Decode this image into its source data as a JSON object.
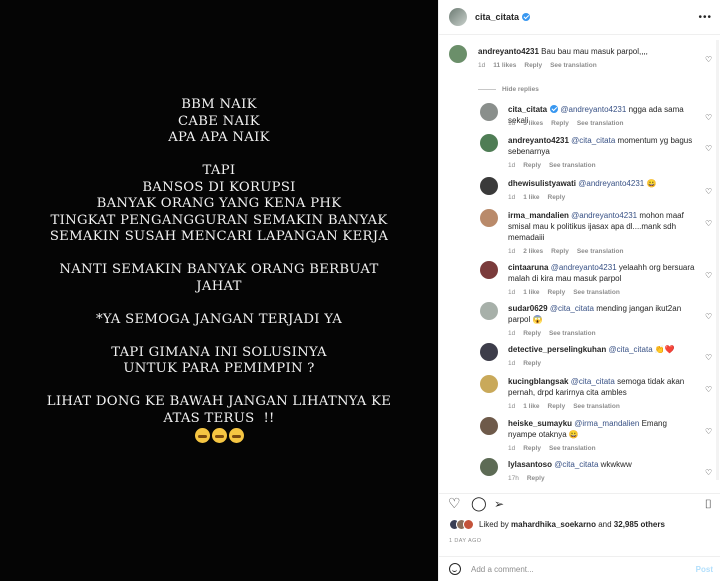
{
  "post": {
    "image_lines": [
      "BBM NAIK",
      "CABE NAIK",
      "APA APA NAIK",
      "",
      "TAPI",
      "BANSOS DI KORUPSI",
      "BANYAK ORANG YANG KENA PHK",
      "TINGKAT PENGANGGURAN SEMAKIN BANYAK",
      "SEMAKIN SUSAH MENCARI LAPANGAN KERJA",
      "",
      "NANTI SEMAKIN BANYAK ORANG BERBUAT",
      "JAHAT",
      "",
      "*YA SEMOGA JANGAN TERJADI YA",
      "",
      "TAPI GIMANA INI SOLUSINYA",
      "UNTUK PARA PEMIMPIN ?",
      "",
      "LIHAT DONG KE BAWAH JANGAN LIHATNYA KE",
      "ATAS TERUS  !!"
    ],
    "emoji": "crying-faces"
  },
  "header": {
    "username": "cita_citata",
    "verified": true
  },
  "comments": [
    {
      "user": "andreyanto4231",
      "mention": "",
      "text": "Bau bau mau masuk parpol,,,,",
      "time": "1d",
      "likes": "11 likes",
      "reply": "Reply",
      "translate": "See translation"
    },
    {
      "user": "cita_citata",
      "verified": true,
      "mention": "@andreyanto4231",
      "text": "ngga ada sama sekali",
      "time": "1d",
      "likes": "5 likes",
      "reply": "Reply",
      "translate": "See translation"
    },
    {
      "user": "andreyanto4231",
      "mention": "@cita_citata",
      "text": "momentum yg bagus sebenarnya",
      "time": "1d",
      "likes": "",
      "reply": "Reply",
      "translate": "See translation"
    },
    {
      "user": "dhewisulistyawati",
      "mention": "@andreyanto4231",
      "text": "😀",
      "time": "1d",
      "likes": "1 like",
      "reply": "Reply",
      "translate": ""
    },
    {
      "user": "irma_mandalien",
      "mention": "@andreyanto4231",
      "text": "mohon maaf smisal mau k politikus ijasax apa dl....mank sdh memadaiii",
      "time": "1d",
      "likes": "2 likes",
      "reply": "Reply",
      "translate": "See translation"
    },
    {
      "user": "cintaaruna",
      "mention": "@andreyanto4231",
      "text": "yelaahh org bersuara malah di kira mau masuk parpol",
      "time": "1d",
      "likes": "1 like",
      "reply": "Reply",
      "translate": "See translation"
    },
    {
      "user": "sudar0629",
      "mention": "@cita_citata",
      "text": "mending jangan ikut2an parpol 😱",
      "time": "1d",
      "likes": "",
      "reply": "Reply",
      "translate": "See translation"
    },
    {
      "user": "detective_perselingkuhan",
      "mention": "@cita_citata",
      "text": "👏❤️",
      "time": "1d",
      "likes": "",
      "reply": "Reply",
      "translate": ""
    },
    {
      "user": "kucingblangsak",
      "mention": "@cita_citata",
      "text": "semoga tidak akan pernah, drpd karirnya cita ambles",
      "time": "1d",
      "likes": "1 like",
      "reply": "Reply",
      "translate": "See translation"
    },
    {
      "user": "heiske_sumayku",
      "mention": "@irma_mandalien",
      "text": "Emang nyampe otaknya 😀",
      "time": "1d",
      "likes": "",
      "reply": "Reply",
      "translate": "See translation"
    },
    {
      "user": "lylasantoso",
      "mention": "@cita_citata",
      "text": "wkwkww",
      "time": "17h",
      "likes": "",
      "reply": "Reply",
      "translate": ""
    }
  ],
  "hide_replies": "Hide replies",
  "likes_line": {
    "prefix": "Liked by",
    "user": "mahardhika_soekarno",
    "and": "and",
    "others": "32,985 others"
  },
  "date": "1 DAY AGO",
  "comment_box": {
    "placeholder": "Add a comment...",
    "post_label": "Post"
  },
  "colors": {
    "link": "#385185",
    "verified": "#3897f0",
    "muted": "#8e8e8e"
  }
}
